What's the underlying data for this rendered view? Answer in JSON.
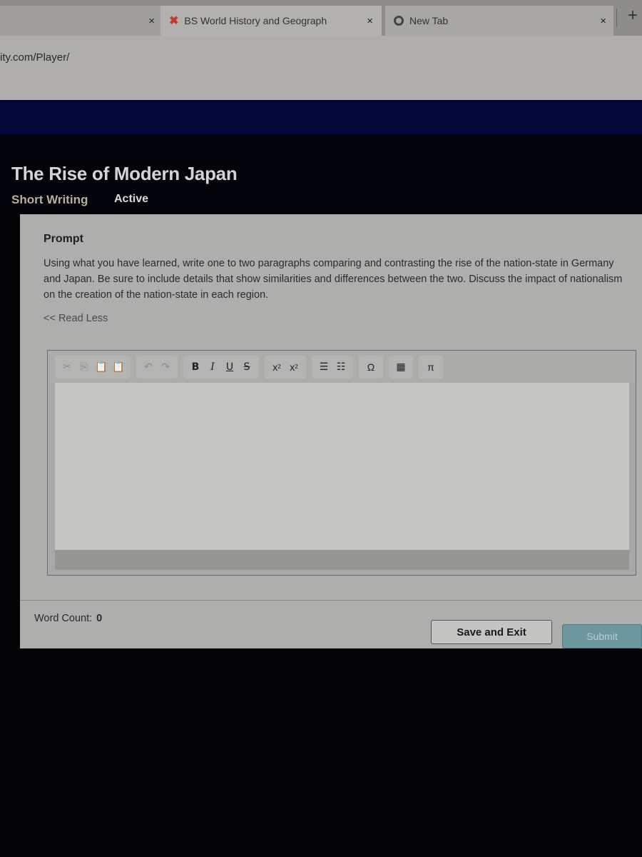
{
  "browser": {
    "tabs": [
      {
        "title": "",
        "icon": "blank-tab",
        "close_label": "×"
      },
      {
        "title": "BS World History and Geograph",
        "icon": "app-logo-x",
        "close_label": "×",
        "active": true
      },
      {
        "title": "New Tab",
        "icon": "chrome-icon",
        "close_label": "×"
      }
    ],
    "new_tab_label": "+",
    "url": "ity.com/Player/"
  },
  "header": {
    "title": "The Rise of Modern Japan",
    "activity_type": "Short Writing",
    "status": "Active"
  },
  "prompt": {
    "label": "Prompt",
    "text": "Using what you have learned, write one to two paragraphs comparing and contrasting the rise of the nation-state in Germany and Japan. Be sure to include details that show similarities and differences between the two. Discuss the impact of nationalism on the creation of the nation-state in each region.",
    "toggle_label": "<< Read Less"
  },
  "editor": {
    "toolbar": {
      "cut": "✂",
      "copy": "⎘",
      "paste": "📋",
      "paste_text": "📋",
      "undo": "↶",
      "redo": "↷",
      "bold": "B",
      "italic": "I",
      "underline": "U",
      "strike": "S",
      "subscript": "x",
      "superscript": "x",
      "numbered_list": "☰",
      "bullet_list": "☷",
      "special_char": "Ω",
      "table": "▦",
      "math": "π"
    },
    "content": ""
  },
  "footer": {
    "word_count_label": "Word Count:",
    "word_count": "0",
    "save_label": "Save and Exit",
    "submit_label": "Submit"
  },
  "colors": {
    "app_bar": "#03073a",
    "submit": "#6c979e"
  }
}
